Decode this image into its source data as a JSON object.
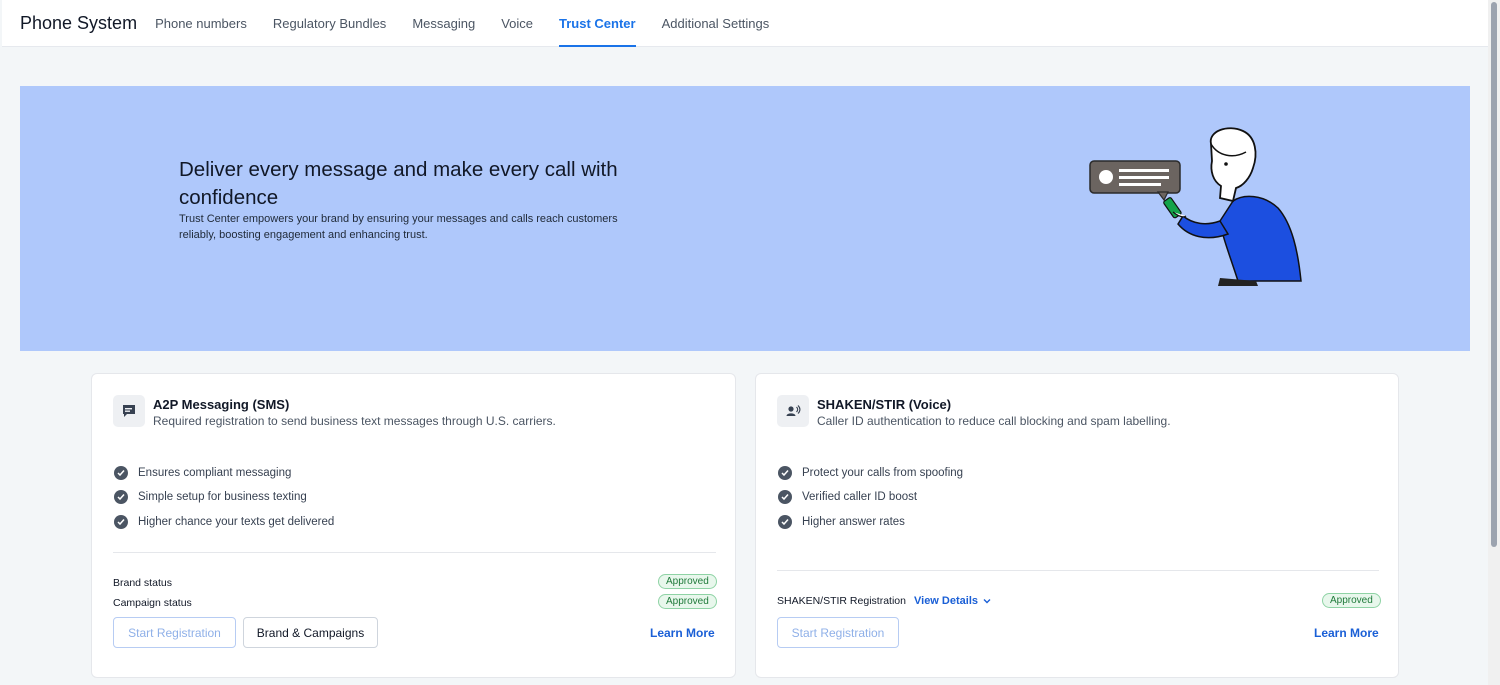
{
  "app": {
    "title": "Phone System"
  },
  "tabs": [
    {
      "label": "Phone numbers"
    },
    {
      "label": "Regulatory Bundles"
    },
    {
      "label": "Messaging"
    },
    {
      "label": "Voice"
    },
    {
      "label": "Trust Center"
    },
    {
      "label": "Additional Settings"
    }
  ],
  "active_tab": "Trust Center",
  "hero": {
    "title": "Deliver every message and make every call with confidence",
    "description": "Trust Center empowers your brand by ensuring your messages and calls reach customers reliably, boosting engagement and enhancing trust.",
    "bg_color": "#afc8fb"
  },
  "a2p": {
    "title": "A2P Messaging (SMS)",
    "subtitle": "Required registration to send business text messages through U.S. carriers.",
    "features": [
      "Ensures compliant messaging",
      "Simple setup for business texting",
      "Higher chance your texts get delivered"
    ],
    "brand_status_label": "Brand status",
    "brand_status": "Approved",
    "campaign_status_label": "Campaign status",
    "campaign_status": "Approved",
    "start_btn": "Start Registration",
    "brand_btn": "Brand & Campaigns",
    "learn_more": "Learn More"
  },
  "shaken": {
    "title": "SHAKEN/STIR (Voice)",
    "subtitle": "Caller ID authentication to reduce call blocking and spam labelling.",
    "features": [
      "Protect your calls from spoofing",
      "Verified caller ID boost",
      "Higher answer rates"
    ],
    "registration_label": "SHAKEN/STIR Registration",
    "view_details": "View Details",
    "registration_status": "Approved",
    "start_btn": "Start Registration",
    "learn_more": "Learn More"
  },
  "colors": {
    "accent": "#1a73e8",
    "approved_text": "#1f7a3a",
    "approved_bg": "#e8f7ec"
  },
  "icons": {
    "a2p": "chat-bubble-icon",
    "shaken": "caller-voice-icon",
    "feature": "check-circle-icon",
    "view_details": "chevron-down-icon"
  }
}
